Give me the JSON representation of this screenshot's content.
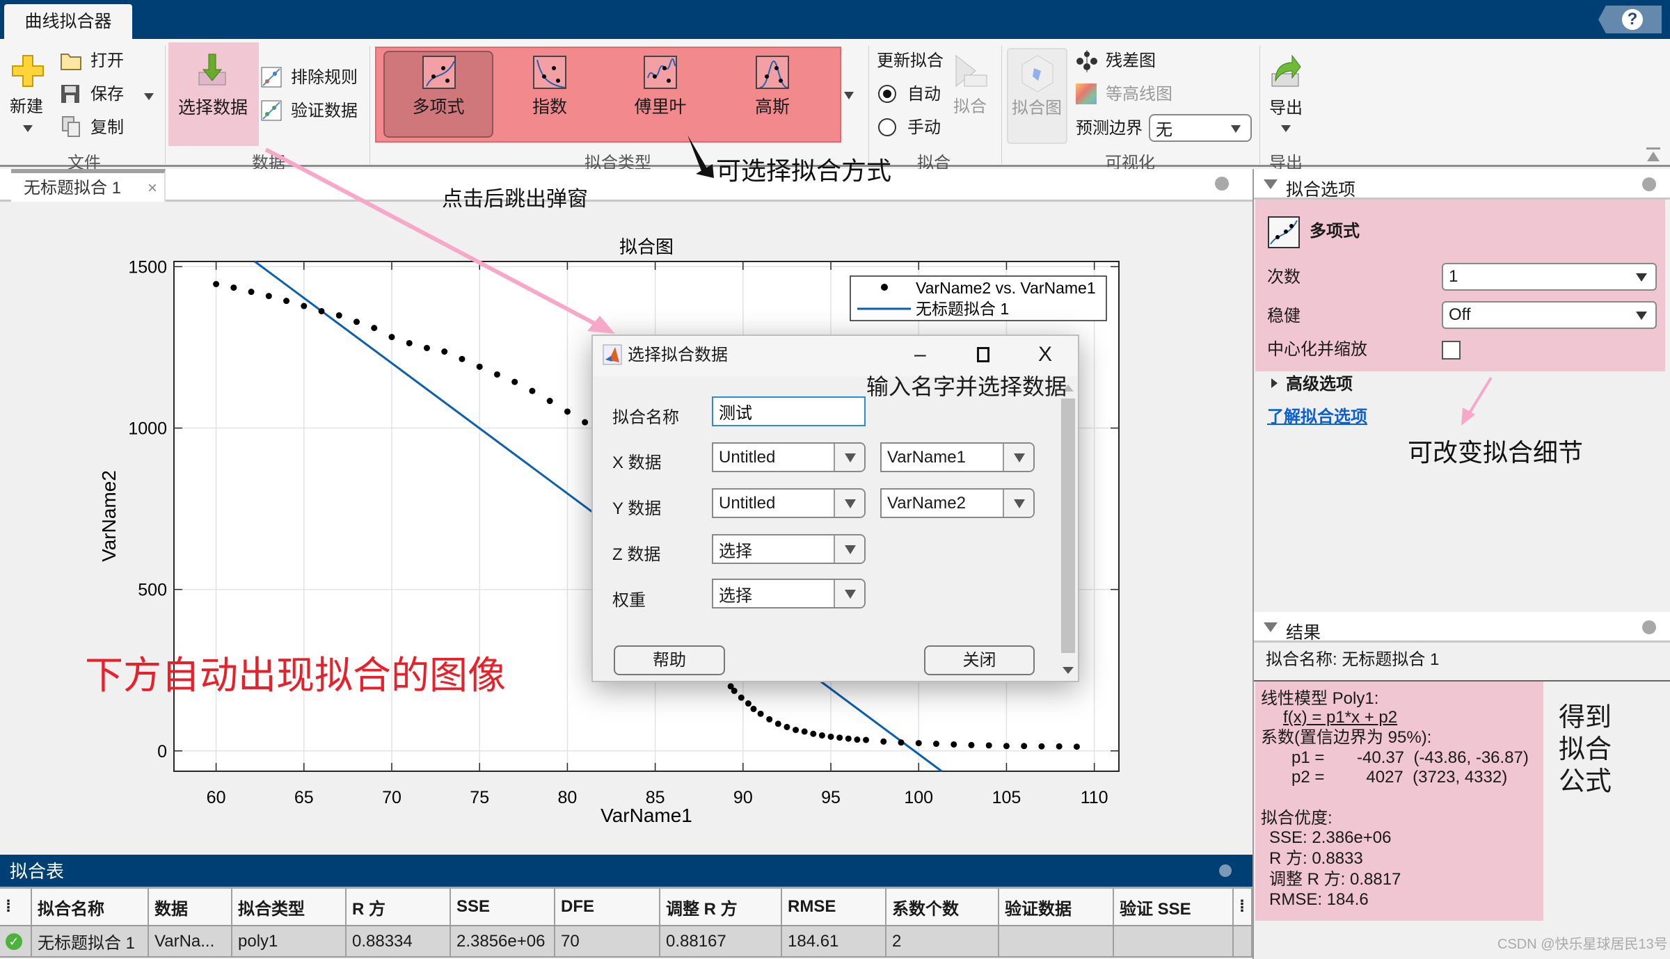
{
  "app": {
    "tab": "曲线拟合器",
    "help_icon": "help-icon"
  },
  "ribbon": {
    "file": {
      "new": "新建",
      "open": "打开",
      "save": "保存",
      "copy": "复制",
      "section": "文件"
    },
    "data": {
      "select": "选择数据",
      "exclude": "排除规则",
      "validate": "验证数据",
      "section": "数据"
    },
    "fit_type": {
      "items": [
        "多项式",
        "指数",
        "傅里叶",
        "高斯"
      ],
      "selected": "多项式",
      "section": "拟合类型"
    },
    "fit": {
      "update": "更新拟合",
      "auto": "自动",
      "manual": "手动",
      "fit_button": "拟合",
      "auto_selected": true,
      "section": "拟合"
    },
    "visualize": {
      "fit_plot": "拟合图",
      "residual": "残差图",
      "contour": "等高线图",
      "bounds_label": "预测边界",
      "bounds_value": "无",
      "section": "可视化"
    },
    "export": {
      "export": "导出",
      "section": "导出"
    }
  },
  "doc_tab": {
    "label": "无标题拟合 1",
    "close": "×"
  },
  "chart_data": {
    "type": "scatter",
    "title": "拟合图",
    "xlabel": "VarName1",
    "ylabel": "VarName2",
    "xlim": [
      57.6,
      111.4
    ],
    "ylim": [
      -63,
      1516
    ],
    "xticks": [
      60,
      65,
      70,
      75,
      80,
      85,
      90,
      95,
      100,
      105,
      110
    ],
    "yticks": [
      0,
      500,
      1000,
      1500
    ],
    "grid": true,
    "legend": {
      "placement": "top-right",
      "entries": [
        "VarName2 vs. VarName1",
        "无标题拟合 1"
      ]
    },
    "series": [
      {
        "name": "VarName2 vs. VarName1",
        "kind": "points",
        "color": "#000000",
        "x": [
          60,
          61,
          62,
          63,
          64,
          65,
          66,
          67,
          68,
          69,
          70,
          71,
          72,
          73,
          74,
          75,
          76,
          77,
          78,
          79,
          80,
          81,
          82,
          83,
          84,
          85,
          86,
          87,
          88,
          89,
          89.3,
          89.5,
          89.9,
          90.3,
          90.6,
          91,
          91.5,
          92,
          92.5,
          93,
          93.5,
          94,
          94.5,
          95,
          95.5,
          96,
          96.5,
          97,
          98,
          99,
          100,
          101,
          102,
          103,
          104,
          105,
          106,
          107,
          108,
          109
        ],
        "y": [
          1446,
          1435,
          1422,
          1409,
          1394,
          1378,
          1362,
          1349,
          1329,
          1310,
          1282,
          1263,
          1248,
          1237,
          1214,
          1190,
          1166,
          1143,
          1115,
          1084,
          1051,
          1018,
          980,
          940,
          890,
          830,
          750,
          640,
          500,
          300,
          200,
          186,
          165,
          147,
          130,
          115,
          98,
          84,
          74,
          65,
          60,
          53,
          48,
          44,
          41,
          38,
          35,
          34,
          29,
          26,
          24,
          22,
          20,
          18,
          17,
          15,
          15,
          14,
          14,
          13
        ]
      },
      {
        "name": "无标题拟合 1",
        "kind": "line",
        "color": "#0b5fb0",
        "p1": -40.37,
        "p2": 4027
      }
    ]
  },
  "dialog": {
    "title": "选择拟合数据",
    "minimize": "–",
    "maximize": "☐",
    "close": "X",
    "fit_name_label": "拟合名称",
    "fit_name_value": "测试",
    "x_label": "X 数据",
    "x_ws": "Untitled",
    "x_var": "VarName1",
    "y_label": "Y 数据",
    "y_ws": "Untitled",
    "y_var": "VarName2",
    "z_label": "Z 数据",
    "z_value": "选择",
    "w_label": "权重",
    "w_value": "选择",
    "help": "帮助",
    "close_button": "关闭"
  },
  "fit_options": {
    "header": "拟合选项",
    "model": "多项式",
    "degree_label": "次数",
    "degree_value": "1",
    "robust_label": "稳健",
    "robust_value": "Off",
    "center_label": "中心化并缩放",
    "center_checked": false,
    "advanced": "高级选项",
    "learn_link": "了解拟合选项"
  },
  "results": {
    "header": "结果",
    "fit_name": "拟合名称: 无标题拟合 1",
    "lines": [
      "线性模型 Poly1:",
      "f(x) = p1*x + p2",
      "系数(置信边界为 95%):",
      "p1 =       -40.37  (-43.86, -36.87)",
      "p2 =         4027  (3723, 4332)",
      "拟合优度:",
      "SSE: 2.386e+06",
      "R 方: 0.8833",
      "调整 R 方: 0.8817",
      "RMSE: 184.6"
    ]
  },
  "table": {
    "header": "拟合表",
    "columns": [
      "拟合名称",
      "数据",
      "拟合类型",
      "R 方",
      "SSE",
      "DFE",
      "调整 R 方",
      "RMSE",
      "系数个数",
      "验证数据",
      "验证 SSE"
    ],
    "rows": [
      [
        "无标题拟合 1",
        "VarNa...",
        "poly1",
        "0.88334",
        "2.3856e+06",
        "70",
        "0.88167",
        "184.61",
        "2",
        "",
        ""
      ]
    ]
  },
  "annotations": {
    "popup": "点击后跳出弹窗",
    "fit_types": "可选择拟合方式",
    "dialog": "输入名字并选择数据",
    "plot": "下方自动出现拟合的图像",
    "options": "可改变拟合细节",
    "formula": [
      "得到",
      "拟合",
      "公式"
    ]
  },
  "watermark": "CSDN @快乐星球居民13号",
  "colors": {
    "title_bar": "#003f73",
    "fit_line": "#0b5fb0",
    "highlight_pink": "#f0becd",
    "highlight_red": "#f06e73",
    "annotation_red": "#e8202a",
    "link": "#0b5fd6"
  }
}
